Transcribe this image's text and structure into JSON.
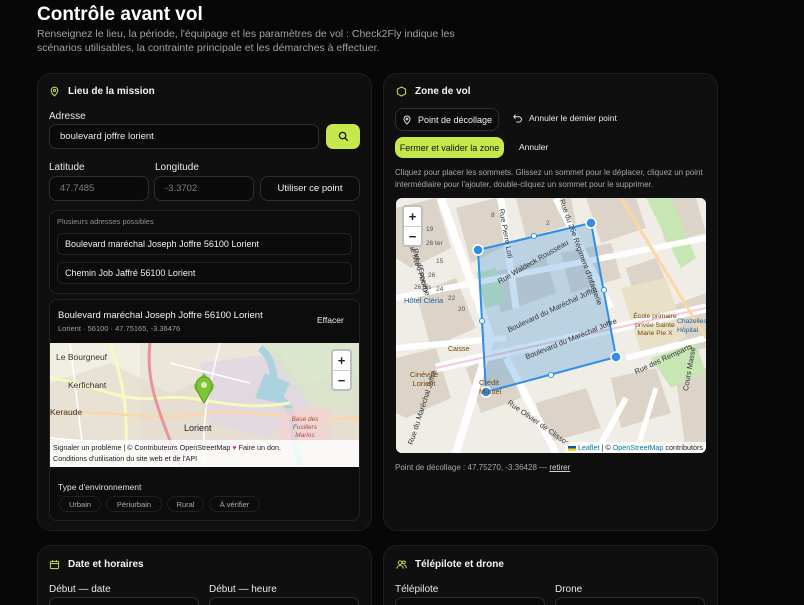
{
  "page": {
    "title": "Contrôle avant vol",
    "subtitle": "Renseignez le lieu, la période, l'équipage et les paramètres de vol : Check2Fly indique les scénarios utilisables, la contrainte principale et les démarches à effectuer."
  },
  "mission": {
    "heading": "Lieu de la mission",
    "address_label": "Adresse",
    "address_value": "boulevard joffre lorient",
    "search_icon": "search-icon",
    "latitude_label": "Latitude",
    "latitude_value": "47.7485",
    "longitude_label": "Longitude",
    "longitude_value": "-3.3702",
    "use_point_label": "Utiliser ce point",
    "suggestions_title": "Plusieurs adresses possibles",
    "suggestions": [
      "Boulevard maréchal Joseph Joffre 56100 Lorient",
      "Chemin Job Jaffré 56100 Lorient"
    ],
    "selected": {
      "name": "Boulevard maréchal Joseph Joffre 56100 Lorient",
      "details": "Lorient · 56100 · 47.75165, -3.36476",
      "clear_label": "Effacer"
    },
    "map": {
      "labels": [
        "Le Bourgneuf",
        "Kerfichant",
        "Keraude",
        "Lorient",
        "Base des Fusiliers Marins"
      ],
      "zoom_in": "+",
      "zoom_out": "−",
      "attribution_line1_a": "Signaler un problème",
      "attribution_line1_b": "| © Contributeurs OpenStreetMap",
      "attribution_line1_c": "Faire un don.",
      "attribution_line2": "Conditions d'utilisation du site web et de l'API"
    },
    "environment_label": "Type d'environnement",
    "environment_options": [
      "Urbain",
      "Périurbain",
      "Rural",
      "À vérifier"
    ]
  },
  "zone": {
    "heading": "Zone de vol",
    "takeoff_button": "Point de décollage",
    "undo_button": "Annuler le dernier point",
    "close_validate_button": "Fermer et valider la zone",
    "cancel_button": "Annuler",
    "help_text": "Cliquez pour placer les sommets. Glissez un sommet pour le déplacer, cliquez un point intermédiaire pour l'ajouter, double-cliquez un sommet pour le supprimer.",
    "map": {
      "streets": [
        "Rue Marc Pourpe",
        "Rue Pierre Loti",
        "Rue du 26e Régiment d'Infanterie",
        "Rue Waldeck Rousseau",
        "Boulevard du Maréchal Joffre",
        "Boulevard du Maréchal Joffre",
        "Rue des Remparts",
        "Rue Olivier de Clisson",
        "Cours Massé",
        "Rue d'Esperey",
        "Rue du Maréchal Joffre"
      ],
      "pois": [
        "Hôtel Cléria",
        "Cinéville Lorient",
        "Crédit Mutuel",
        "École primaire privée Sainte Marie Pie X",
        "Chazelles Hôpital",
        "Caisse"
      ],
      "house_numbers": [
        "19",
        "15",
        "26",
        "24",
        "22",
        "20",
        "26 bis",
        "26 ter",
        "8",
        "2"
      ],
      "zoom_in": "+",
      "zoom_out": "−",
      "attribution_leaflet": "Leaflet",
      "attribution_osm": "OpenStreetMap",
      "attribution_rest": " contributors"
    },
    "takeoff_info_prefix": "Point de décollage : 47.75270, -3.36428 —",
    "takeoff_remove": "retirer"
  },
  "schedule": {
    "heading": "Date et horaires",
    "start_date_label": "Début — date",
    "start_time_label": "Début — heure"
  },
  "crew": {
    "heading": "Télépilote et drone",
    "pilot_label": "Télépilote",
    "drone_label": "Drone"
  },
  "colors": {
    "accent": "#c6e84a",
    "background": "#070707",
    "card": "#0f0f0f",
    "polygon": "#2f8fe8",
    "marker": "#7ec336"
  }
}
